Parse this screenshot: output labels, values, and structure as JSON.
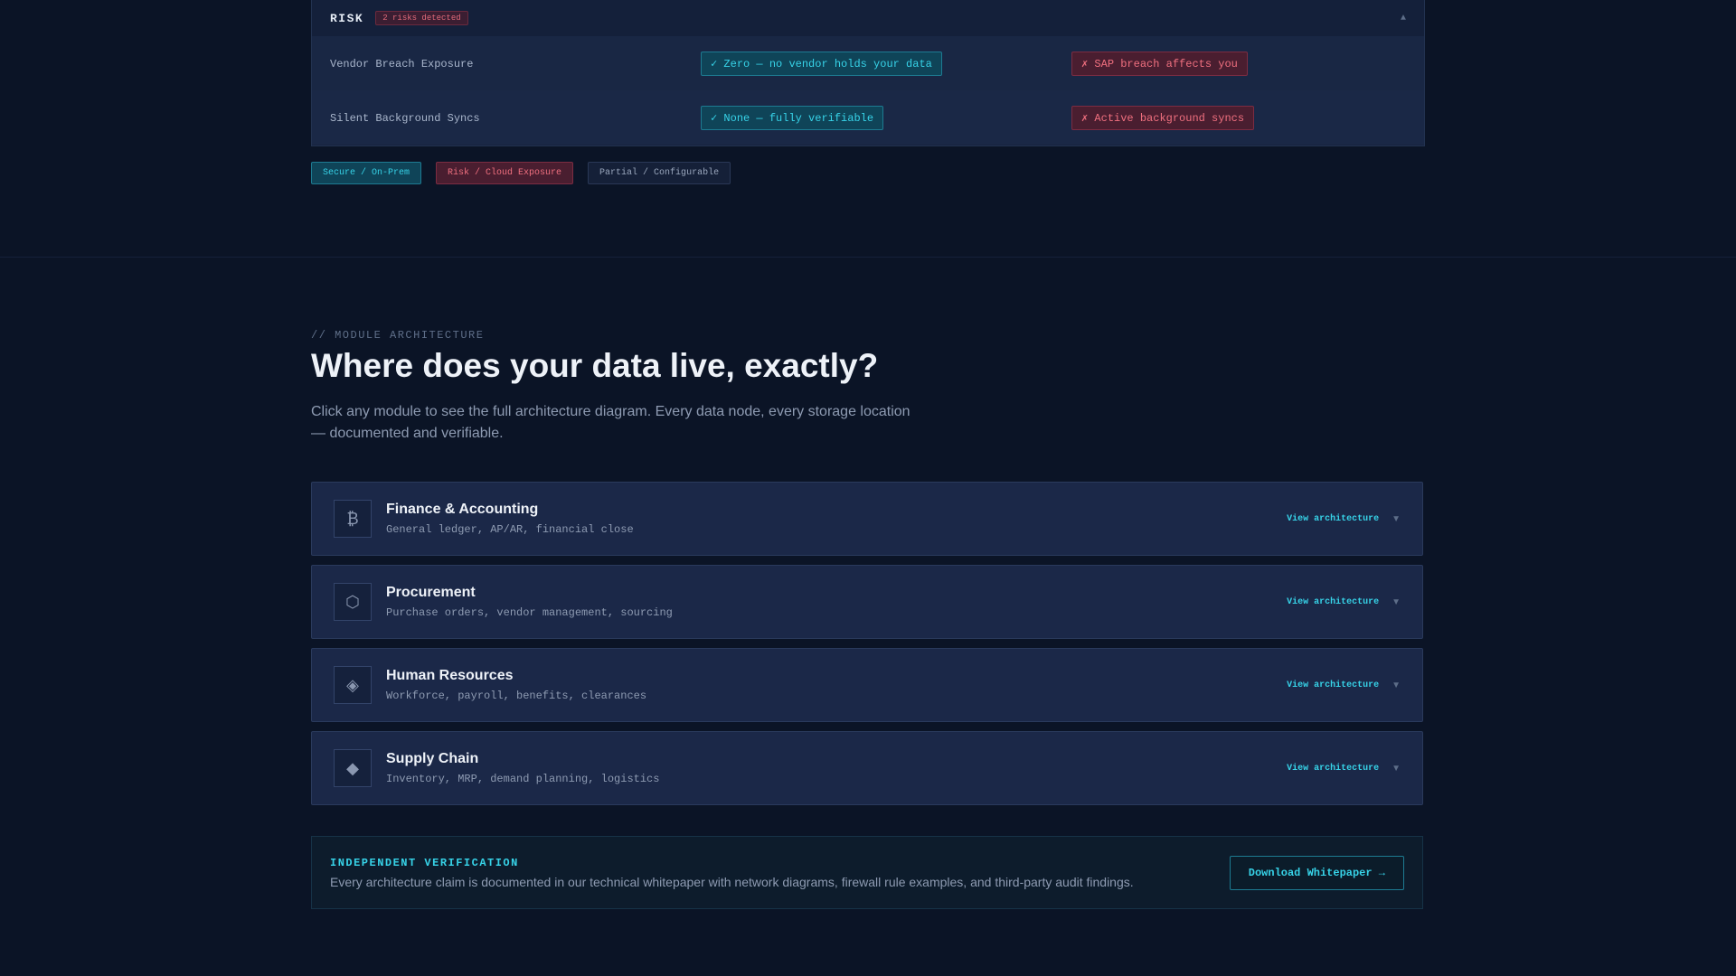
{
  "risk": {
    "title": "RISK",
    "badge": "2 risks detected",
    "caret": "▲",
    "rows": [
      {
        "label": "Vendor Breach Exposure",
        "secure": "✓ Zero — no vendor holds your data",
        "cloud": "✗ SAP breach affects you"
      },
      {
        "label": "Silent Background Syncs",
        "secure": "✓ None — fully verifiable",
        "cloud": "✗ Active background syncs"
      }
    ]
  },
  "legend": {
    "secure": "Secure / On-Prem",
    "risk": "Risk / Cloud Exposure",
    "partial": "Partial / Configurable"
  },
  "section": {
    "eyebrow": "// MODULE ARCHITECTURE",
    "title": "Where does your data live, exactly?",
    "lead": "Click any module to see the full architecture diagram. Every data node, every storage location — documented and verifiable."
  },
  "modules": [
    {
      "icon": "bitcoin-icon",
      "glyph": "₿",
      "title": "Finance & Accounting",
      "sub": "General ledger, AP/AR, financial close",
      "link": "View architecture",
      "caret": "▼"
    },
    {
      "icon": "hexagon-icon",
      "glyph": "⬡",
      "title": "Procurement",
      "sub": "Purchase orders, vendor management, sourcing",
      "link": "View architecture",
      "caret": "▼"
    },
    {
      "icon": "diamond-outline-icon",
      "glyph": "◈",
      "title": "Human Resources",
      "sub": "Workforce, payroll, benefits, clearances",
      "link": "View architecture",
      "caret": "▼"
    },
    {
      "icon": "diamond-icon",
      "glyph": "◆",
      "title": "Supply Chain",
      "sub": "Inventory, MRP, demand planning, logistics",
      "link": "View architecture",
      "caret": "▼"
    }
  ],
  "verification": {
    "title": "INDEPENDENT VERIFICATION",
    "desc": "Every architecture claim is documented in our technical whitepaper with network diagrams, firewall rule examples, and third-party audit findings.",
    "button": "Download Whitepaper →"
  },
  "colors": {
    "background": "#0b1426",
    "accent": "#37d3e8",
    "danger": "#f0707f"
  }
}
